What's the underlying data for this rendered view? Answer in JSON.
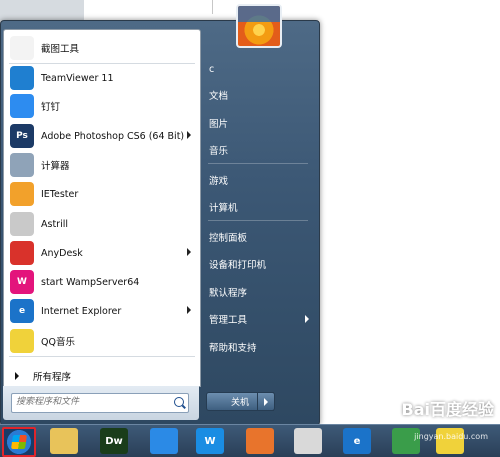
{
  "programs": [
    {
      "label": "截图工具",
      "icon": "snipping-tool-icon",
      "color": "#f3f3f3",
      "text": "",
      "arrow": false
    },
    {
      "label": "TeamViewer 11",
      "icon": "teamviewer-icon",
      "color": "#1f7fd0",
      "text": "",
      "arrow": false
    },
    {
      "label": "钉钉",
      "icon": "dingtalk-icon",
      "color": "#2d8cf0",
      "text": "",
      "arrow": false
    },
    {
      "label": "Adobe Photoshop CS6 (64 Bit)",
      "icon": "photoshop-icon",
      "color": "#1c3a66",
      "text": "Ps",
      "arrow": true
    },
    {
      "label": "计算器",
      "icon": "calculator-icon",
      "color": "#8fa3b8",
      "text": "",
      "arrow": false
    },
    {
      "label": "IETester",
      "icon": "ietester-icon",
      "color": "#f2a12b",
      "text": "",
      "arrow": false
    },
    {
      "label": "Astrill",
      "icon": "astrill-icon",
      "color": "#c9c9c9",
      "text": "",
      "arrow": false
    },
    {
      "label": "AnyDesk",
      "icon": "anydesk-icon",
      "color": "#d9322b",
      "text": "",
      "arrow": true
    },
    {
      "label": "start WampServer64",
      "icon": "wampserver-icon",
      "color": "#e3147c",
      "text": "W",
      "arrow": false
    },
    {
      "label": "Internet Explorer",
      "icon": "internet-explorer-icon",
      "color": "#1b73c9",
      "text": "e",
      "arrow": true
    },
    {
      "label": "QQ音乐",
      "icon": "qqmusic-icon",
      "color": "#f0d23a",
      "text": "",
      "arrow": false
    }
  ],
  "all_programs_label": "所有程序",
  "search": {
    "placeholder": "搜索程序和文件"
  },
  "right_items": [
    {
      "label": "c",
      "arrow": false
    },
    {
      "label": "文档",
      "arrow": false
    },
    {
      "label": "图片",
      "arrow": false
    },
    {
      "label": "音乐",
      "arrow": false
    },
    {
      "label": "游戏",
      "arrow": false
    },
    {
      "label": "计算机",
      "arrow": false
    },
    {
      "label": "控制面板",
      "arrow": false
    },
    {
      "label": "设备和打印机",
      "arrow": false
    },
    {
      "label": "默认程序",
      "arrow": false
    },
    {
      "label": "管理工具",
      "arrow": true
    },
    {
      "label": "帮助和支持",
      "arrow": false
    }
  ],
  "shutdown_label": "关机",
  "taskbar": [
    {
      "name": "explorer-icon",
      "text": "",
      "color": "#e8c35a"
    },
    {
      "name": "dreamweaver-icon",
      "text": "Dw",
      "color": "#1a3d1a"
    },
    {
      "name": "feishu-icon",
      "text": "",
      "color": "#2b8ae6"
    },
    {
      "name": "wampserver-taskbar-icon",
      "text": "W",
      "color": "#1a8de3"
    },
    {
      "name": "firefox-icon",
      "text": "",
      "color": "#e8742c"
    },
    {
      "name": "chrome-icon",
      "text": "",
      "color": "#d9d9d9"
    },
    {
      "name": "ie-taskbar-icon",
      "text": "e",
      "color": "#1b73c9"
    },
    {
      "name": "jingyan-icon",
      "text": "",
      "color": "#3a9d4a"
    },
    {
      "name": "qqmusic-taskbar-icon",
      "text": "",
      "color": "#f0d23a"
    }
  ],
  "watermark": "Bai百度经验",
  "watermark_sub": "jingyan.baidu.com"
}
